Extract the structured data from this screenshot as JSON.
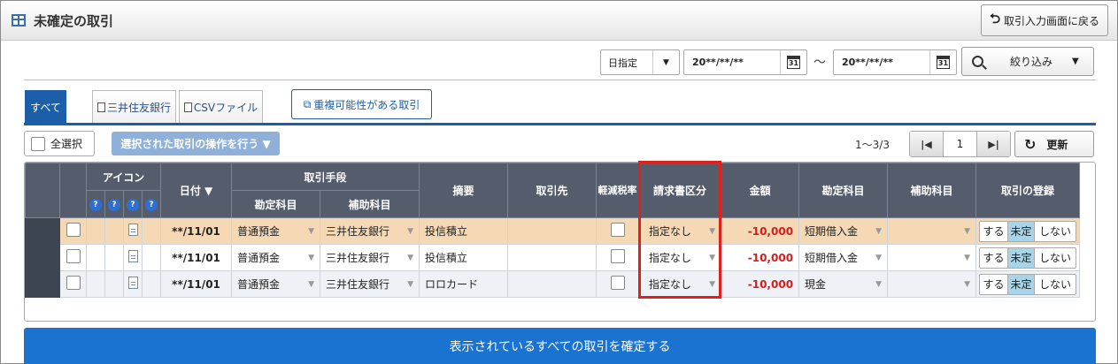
{
  "header": {
    "title": "未確定の取引",
    "back_button": "取引入力画面に戻る"
  },
  "filter": {
    "period_select": "日指定",
    "date_from": "20**/**/**",
    "date_to": "20**/**/**",
    "separator": "〜",
    "calendar_label": "31",
    "filter_button": "絞り込み"
  },
  "tabs": [
    {
      "label": "すべて"
    },
    {
      "label": "三井住友銀行"
    },
    {
      "label": "CSVファイル"
    }
  ],
  "duplicate_button": "重複可能性がある取引",
  "toolbar": {
    "select_all": "全選択",
    "bulk_action": "選択された取引の操作を行う ▼",
    "count": "1〜3/3",
    "page": "1",
    "refresh": "更新"
  },
  "table": {
    "headers": {
      "icon": "アイコン",
      "date": "日付 ▼",
      "means": "取引手段",
      "means_account": "勘定科目",
      "means_sub": "補助科目",
      "summary": "摘要",
      "partner": "取引先",
      "reduced_tax": "軽減税率",
      "invoice": "請求書区分",
      "amount": "金額",
      "account": "勘定科目",
      "sub_account": "補助科目",
      "register": "取引の登録"
    },
    "help_mark": "?",
    "rows": [
      {
        "date": "**/11/01",
        "means_account": "普通預金",
        "means_sub": "三井住友銀行",
        "summary": "投信積立",
        "partner": "",
        "invoice": "指定なし",
        "amount": "-10,000",
        "account": "短期借入金",
        "sub_account": "",
        "opt1": "する",
        "opt2": "未定",
        "opt3": "しない"
      },
      {
        "date": "**/11/01",
        "means_account": "普通預金",
        "means_sub": "三井住友銀行",
        "summary": "投信積立",
        "partner": "",
        "invoice": "指定なし",
        "amount": "-10,000",
        "account": "短期借入金",
        "sub_account": "",
        "opt1": "する",
        "opt2": "未定",
        "opt3": "しない"
      },
      {
        "date": "**/11/01",
        "means_account": "普通預金",
        "means_sub": "三井住友銀行",
        "summary": "ロロカード",
        "partner": "",
        "invoice": "指定なし",
        "amount": "-10,000",
        "account": "現金",
        "sub_account": "",
        "opt1": "する",
        "opt2": "未定",
        "opt3": "しない"
      }
    ]
  },
  "confirm_button": "表示されているすべての取引を確定する",
  "colors": {
    "accent": "#1c5fa8",
    "header_bg": "#555c6b",
    "highlight_border": "#e0201c",
    "amount_negative": "#d02020",
    "confirm_bg": "#1a73d0"
  }
}
